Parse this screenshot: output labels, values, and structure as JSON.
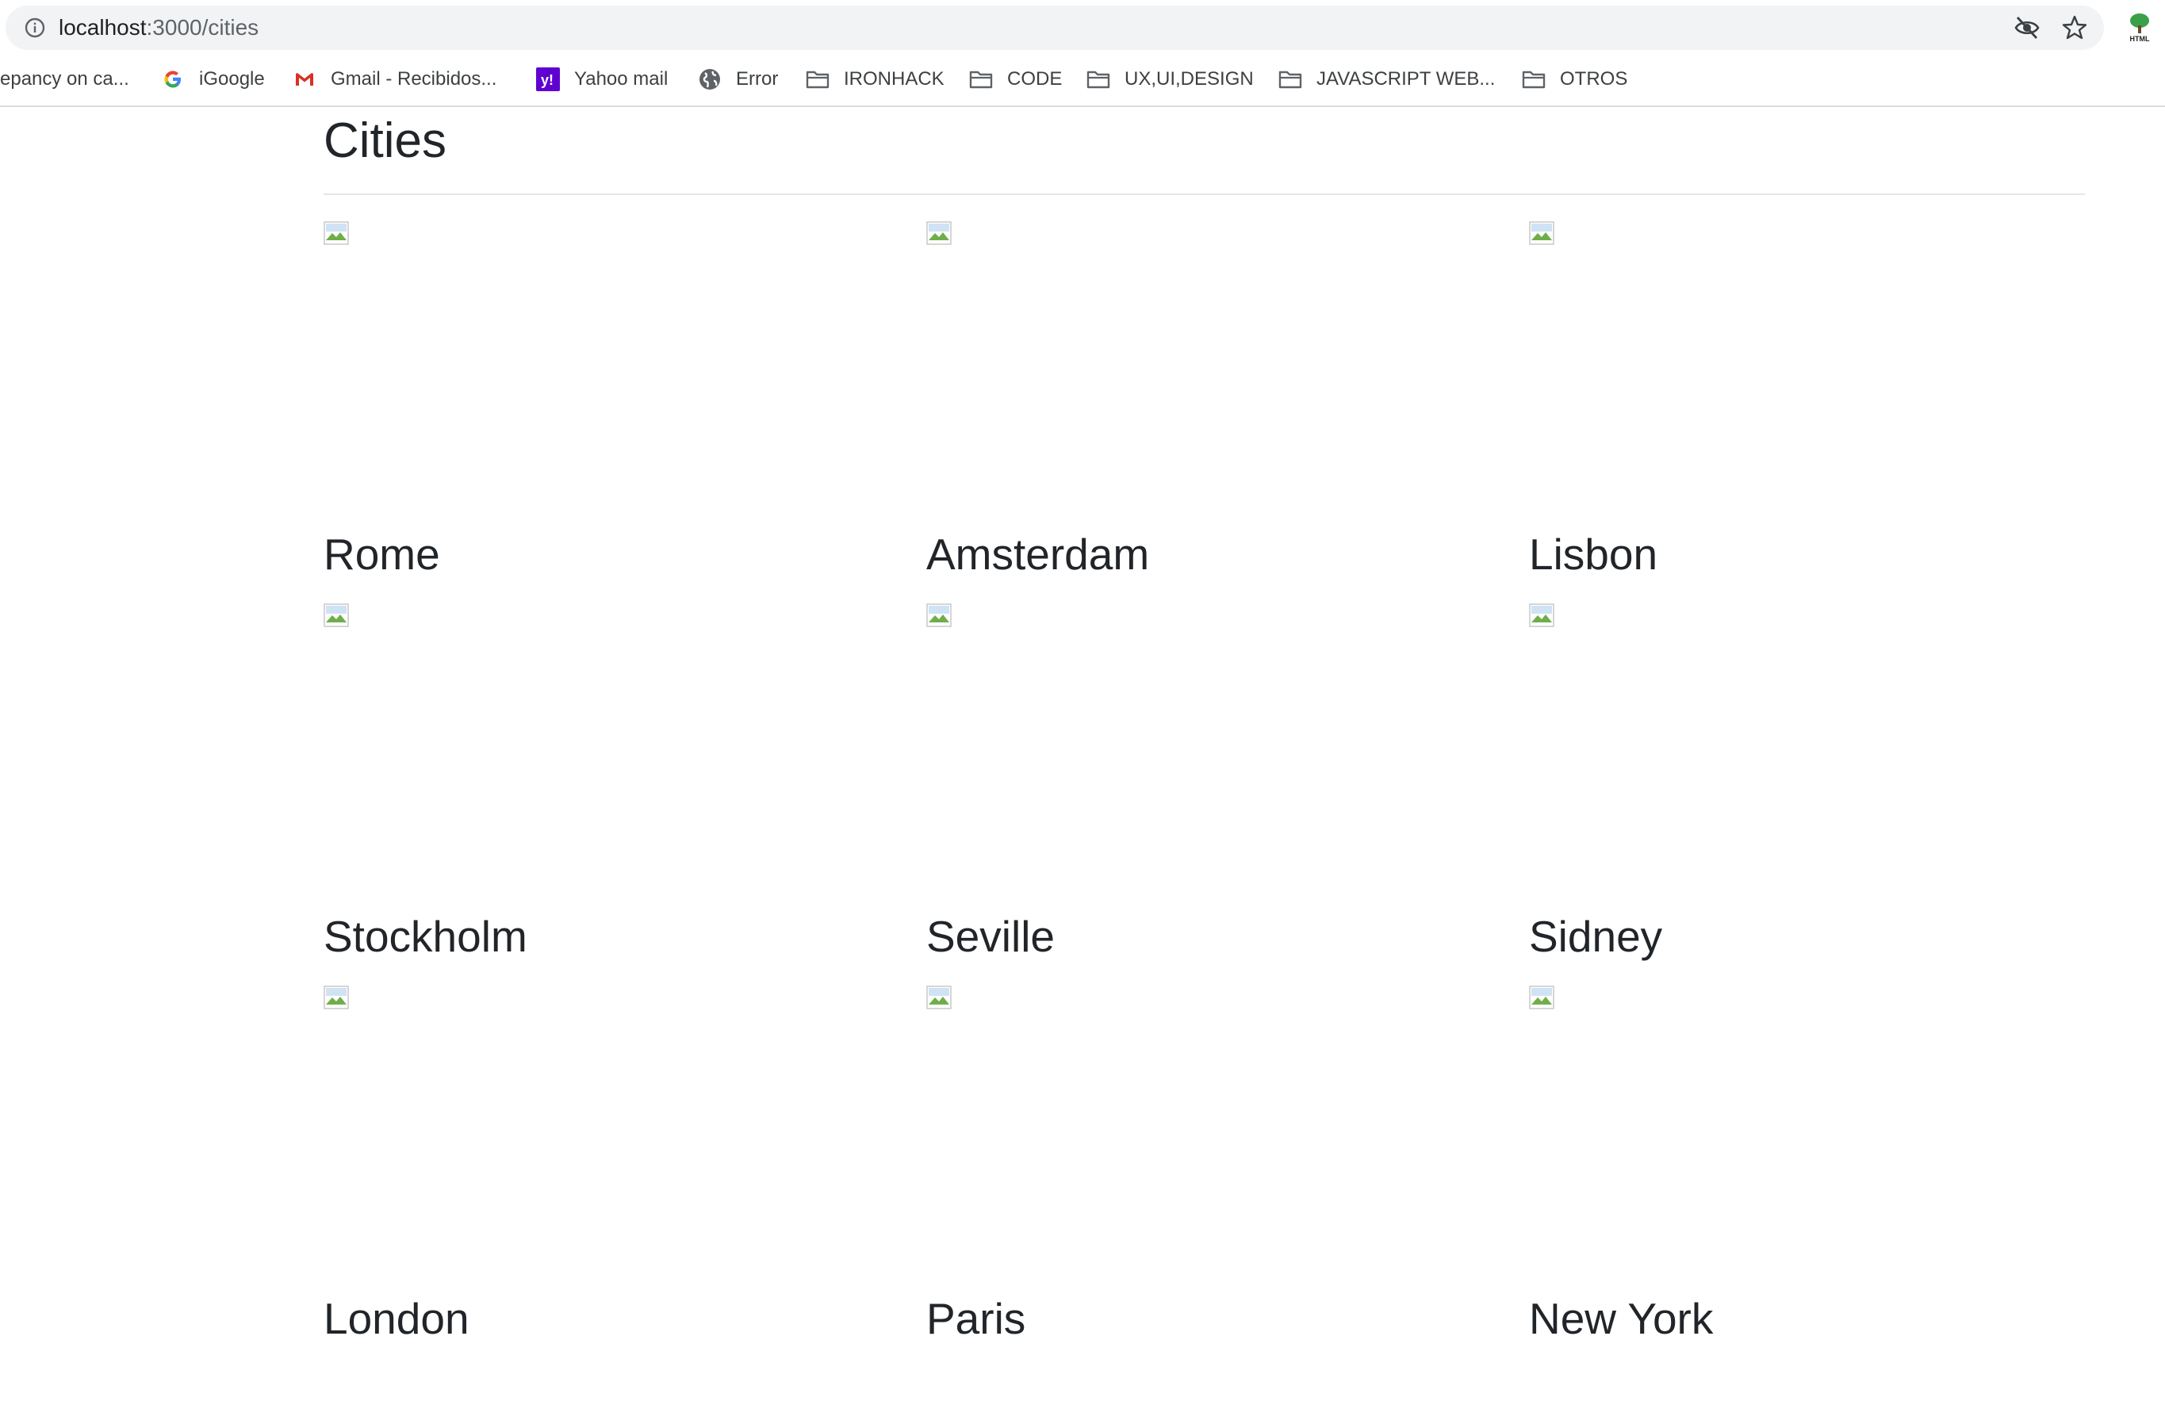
{
  "browser": {
    "url_host": "localhost",
    "url_path": ":3000/cities",
    "bookmarks": [
      {
        "label": "epancy on ca...",
        "icon": "none"
      },
      {
        "label": "iGoogle",
        "icon": "google-icon"
      },
      {
        "label": "Gmail - Recibidos...",
        "icon": "gmail-icon"
      },
      {
        "label": "Yahoo mail",
        "icon": "yahoo-icon"
      },
      {
        "label": "Error",
        "icon": "globe-icon"
      },
      {
        "label": "IRONHACK",
        "icon": "folder-icon"
      },
      {
        "label": "CODE",
        "icon": "folder-icon"
      },
      {
        "label": "UX,UI,DESIGN",
        "icon": "folder-icon"
      },
      {
        "label": "JAVASCRIPT WEB...",
        "icon": "folder-icon"
      },
      {
        "label": "OTROS",
        "icon": "folder-icon"
      }
    ]
  },
  "page": {
    "title": "Cities",
    "cities": [
      {
        "name": "Rome"
      },
      {
        "name": "Amsterdam"
      },
      {
        "name": "Lisbon"
      },
      {
        "name": "Stockholm"
      },
      {
        "name": "Seville"
      },
      {
        "name": "Sidney"
      },
      {
        "name": "London"
      },
      {
        "name": "Paris"
      },
      {
        "name": "New York"
      }
    ]
  }
}
